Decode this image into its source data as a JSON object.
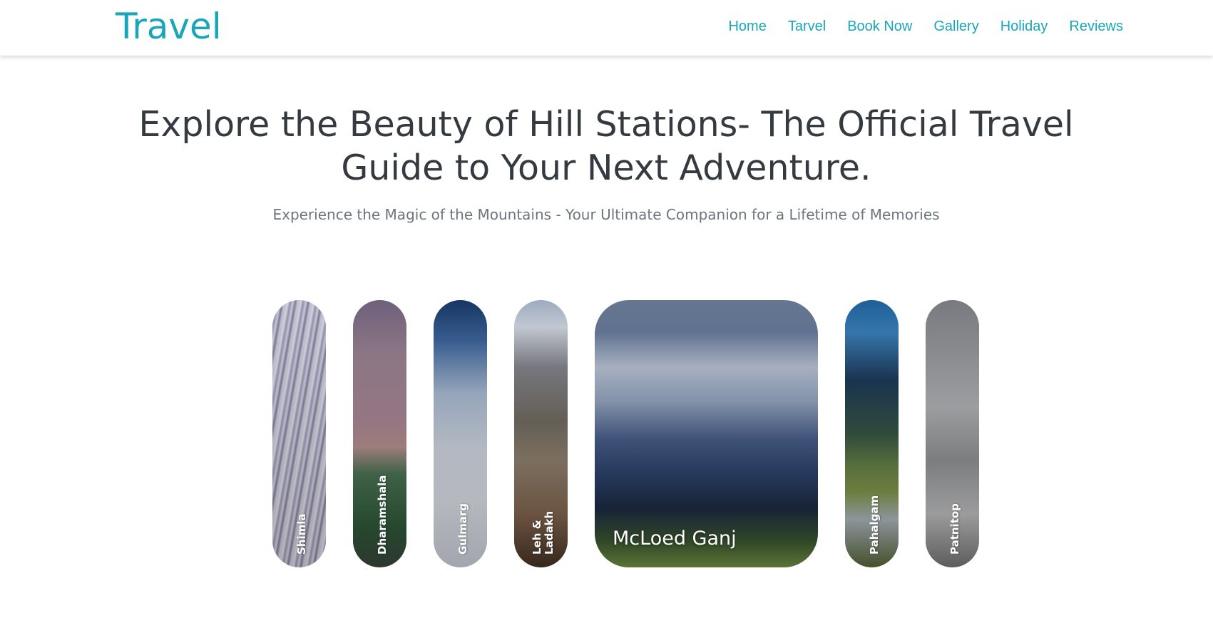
{
  "colors": {
    "brand": "#1aa6b7",
    "heading": "#343a40",
    "subtitle": "#6c757d"
  },
  "navbar": {
    "brand": "Travel",
    "links": [
      "Home",
      "Tarvel",
      "Book Now",
      "Gallery",
      "Holiday",
      "Reviews"
    ]
  },
  "hero": {
    "title": "Explore the Beauty of Hill Stations- The Official Travel Guide to Your Next Adventure.",
    "subtitle": "Experience the Magic of the Mountains - Your Ultimate Companion for a Lifetime of Memories"
  },
  "gallery": {
    "cards": [
      {
        "label": "Shimla"
      },
      {
        "label": "Dharamshala"
      },
      {
        "label": "Gulmarg"
      },
      {
        "label": "Leh & Ladakh"
      },
      {
        "label": "McLoed Ganj",
        "active": true
      },
      {
        "label": "Pahalgam"
      },
      {
        "label": "Patnitop"
      }
    ]
  }
}
